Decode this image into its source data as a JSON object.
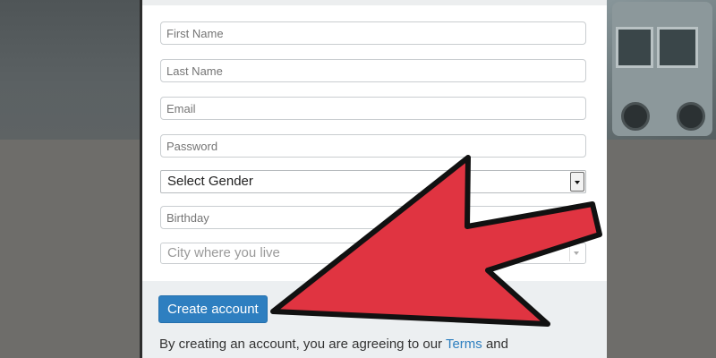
{
  "form": {
    "first_name_placeholder": "First Name",
    "last_name_placeholder": "Last Name",
    "email_placeholder": "Email",
    "password_placeholder": "Password",
    "gender_selected": "Select Gender",
    "birthday_placeholder": "Birthday",
    "city_placeholder": "City where you live"
  },
  "footer": {
    "create_account_label": "Create account",
    "agreement_text": "By creating an account, you are agreeing to our ",
    "terms_link": "Terms",
    "agreement_tail": " and"
  },
  "overlay": {
    "arrow_color": "#e03441",
    "arrow_outline": "#111111"
  },
  "colors": {
    "button_blue": "#2e7fc0",
    "footer_bg": "#eceff1"
  }
}
